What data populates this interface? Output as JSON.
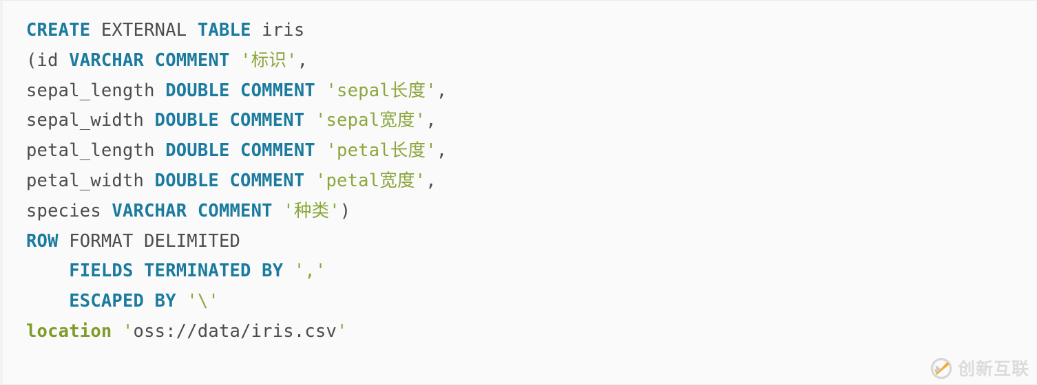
{
  "code_block": {
    "language": "sql",
    "background_color": "#fafafa",
    "colors": {
      "keyword": "#1b7b9e",
      "string": "#8aa73c",
      "plain": "#4c4c4c",
      "builtin": "#7f9c28"
    },
    "lines": [
      {
        "indent": "",
        "tokens": [
          {
            "t": "CREATE",
            "k": "kw"
          },
          {
            "t": " EXTERNAL ",
            "k": "plain"
          },
          {
            "t": "TABLE",
            "k": "kw"
          },
          {
            "t": " iris",
            "k": "plain"
          }
        ]
      },
      {
        "indent": "",
        "tokens": [
          {
            "t": "(id ",
            "k": "plain"
          },
          {
            "t": "VARCHAR COMMENT",
            "k": "kw"
          },
          {
            "t": " ",
            "k": "plain"
          },
          {
            "t": "'标识'",
            "k": "str"
          },
          {
            "t": ",",
            "k": "plain"
          }
        ]
      },
      {
        "indent": "",
        "tokens": [
          {
            "t": "sepal_length ",
            "k": "plain"
          },
          {
            "t": "DOUBLE COMMENT",
            "k": "kw"
          },
          {
            "t": " ",
            "k": "plain"
          },
          {
            "t": "'sepal长度'",
            "k": "str"
          },
          {
            "t": ",",
            "k": "plain"
          }
        ]
      },
      {
        "indent": "",
        "tokens": [
          {
            "t": "sepal_width ",
            "k": "plain"
          },
          {
            "t": "DOUBLE COMMENT",
            "k": "kw"
          },
          {
            "t": " ",
            "k": "plain"
          },
          {
            "t": "'sepal宽度'",
            "k": "str"
          },
          {
            "t": ",",
            "k": "plain"
          }
        ]
      },
      {
        "indent": "",
        "tokens": [
          {
            "t": "petal_length ",
            "k": "plain"
          },
          {
            "t": "DOUBLE COMMENT",
            "k": "kw"
          },
          {
            "t": " ",
            "k": "plain"
          },
          {
            "t": "'petal长度'",
            "k": "str"
          },
          {
            "t": ",",
            "k": "plain"
          }
        ]
      },
      {
        "indent": "",
        "tokens": [
          {
            "t": "petal_width ",
            "k": "plain"
          },
          {
            "t": "DOUBLE COMMENT",
            "k": "kw"
          },
          {
            "t": " ",
            "k": "plain"
          },
          {
            "t": "'petal宽度'",
            "k": "str"
          },
          {
            "t": ",",
            "k": "plain"
          }
        ]
      },
      {
        "indent": "",
        "tokens": [
          {
            "t": "species ",
            "k": "plain"
          },
          {
            "t": "VARCHAR COMMENT",
            "k": "kw"
          },
          {
            "t": " ",
            "k": "plain"
          },
          {
            "t": "'种类'",
            "k": "str"
          },
          {
            "t": ")",
            "k": "plain"
          }
        ]
      },
      {
        "indent": "",
        "tokens": [
          {
            "t": "ROW",
            "k": "kw"
          },
          {
            "t": " FORMAT DELIMITED",
            "k": "plain"
          }
        ]
      },
      {
        "indent": "    ",
        "tokens": [
          {
            "t": "FIELDS TERMINATED BY",
            "k": "kw"
          },
          {
            "t": " ",
            "k": "plain"
          },
          {
            "t": "','",
            "k": "str"
          }
        ]
      },
      {
        "indent": "    ",
        "tokens": [
          {
            "t": "ESCAPED BY",
            "k": "kw"
          },
          {
            "t": " ",
            "k": "plain"
          },
          {
            "t": "'\\'",
            "k": "str"
          }
        ]
      },
      {
        "indent": "",
        "tokens": [
          {
            "t": "location",
            "k": "builtin"
          },
          {
            "t": " ",
            "k": "plain"
          },
          {
            "t": "'",
            "k": "str"
          },
          {
            "t": "oss://data/iris.csv",
            "k": "plain"
          },
          {
            "t": "'",
            "k": "str"
          }
        ]
      }
    ]
  },
  "watermark": {
    "text": "创新互联",
    "logo_icon": "creative-link-logo-icon",
    "text_color": "#d9d9d9",
    "accent_color": "#f5a623"
  }
}
